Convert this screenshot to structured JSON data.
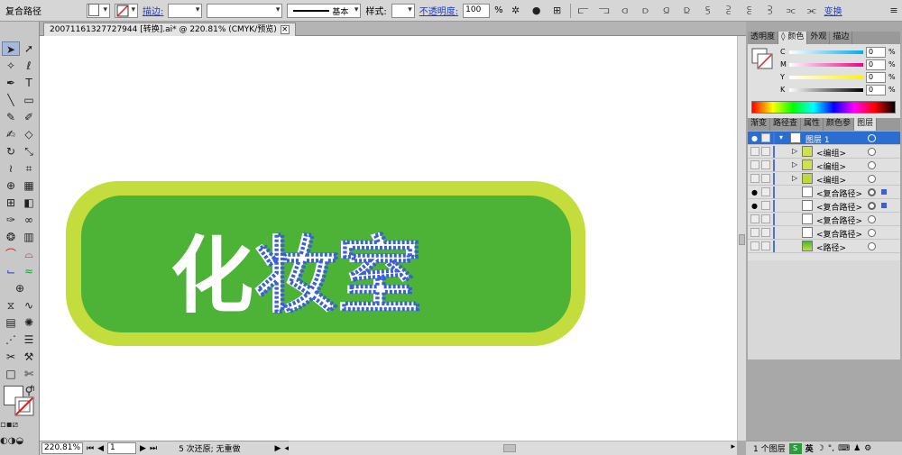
{
  "control_bar": {
    "object_type": "复合路径",
    "stroke_label": "描边:",
    "stroke_style_label": "基本",
    "style_label": "样式:",
    "opacity_label": "不透明度:",
    "opacity_value": "100",
    "opacity_unit": "%",
    "transform_label": "变换"
  },
  "document": {
    "tab_title": "20071161327727944 [转换].ai* @ 220.81% (CMYK/预览)",
    "close_glyph": "✕"
  },
  "artwork": {
    "text": "化妆室",
    "outer_color": "#c4dc3c",
    "inner_color": "#4db337"
  },
  "status_bar": {
    "zoom": "220.81%",
    "page": "1",
    "undo_text": "5 次还原; 无重做"
  },
  "panels": {
    "top_tabs": [
      "透明度",
      "◊ 颜色",
      "外观",
      "描边"
    ],
    "color": {
      "channels": [
        {
          "label": "C",
          "value": "0"
        },
        {
          "label": "M",
          "value": "0"
        },
        {
          "label": "Y",
          "value": "0"
        },
        {
          "label": "K",
          "value": "0"
        }
      ],
      "unit": "%"
    },
    "layer_tabs": [
      "渐变",
      "路径查",
      "属性",
      "颜色参",
      "图层"
    ],
    "layers": [
      {
        "name": "图层 1"
      },
      {
        "name": "<编组>"
      },
      {
        "name": "<编组>"
      },
      {
        "name": "<编组>"
      },
      {
        "name": "<复合路径>"
      },
      {
        "name": "<复合路径>"
      },
      {
        "name": "<复合路径>"
      },
      {
        "name": "<复合路径>"
      },
      {
        "name": "<路径>"
      }
    ],
    "layers_count": "1 个图层"
  },
  "taskbar": {
    "ime": "英"
  },
  "colors": {
    "selection": "#3a5fd8",
    "layer_selected": "#2a6fd0",
    "link": "#1e3cc8"
  }
}
